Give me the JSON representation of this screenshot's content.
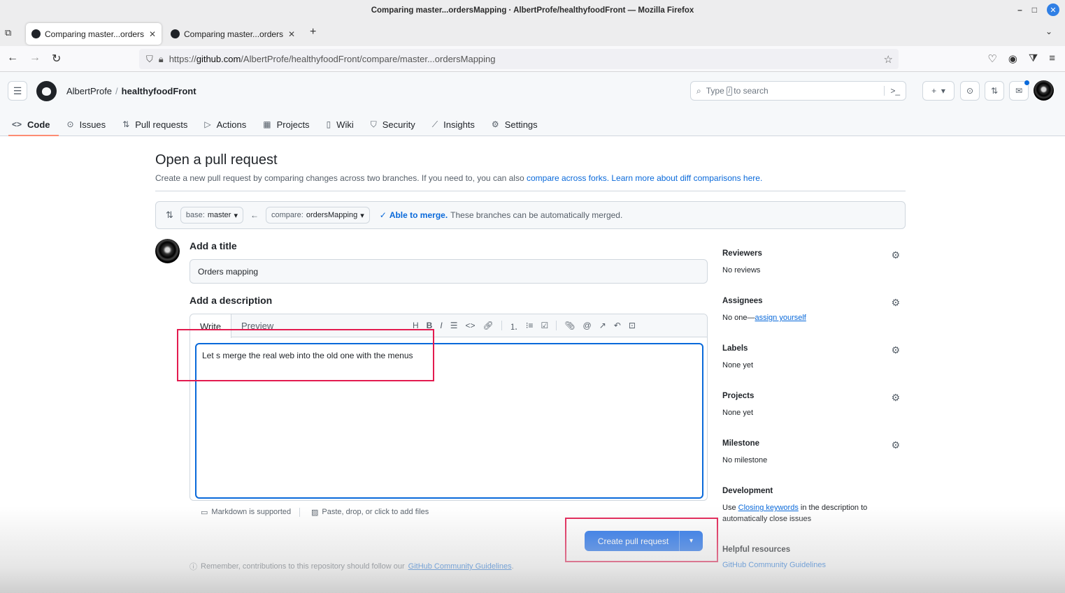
{
  "window": {
    "title": "Comparing master...ordersMapping · AlbertProfe/healthyfoodFront — Mozilla Firefox"
  },
  "tabs": [
    {
      "label": "Comparing master...ordersM"
    },
    {
      "label": "Comparing master...ordersM"
    }
  ],
  "url": {
    "prefix": "https://",
    "domain": "github.com",
    "path": "/AlbertProfe/healthyfoodFront/compare/master...ordersMapping"
  },
  "header": {
    "owner": "AlbertProfe",
    "separator": "/",
    "repo": "healthyfoodFront",
    "search_placeholder_pre": "Type",
    "search_key": "/",
    "search_placeholder_post": "to search"
  },
  "repo_nav": [
    {
      "label": "Code",
      "icon": "<>"
    },
    {
      "label": "Issues",
      "icon": "⊙"
    },
    {
      "label": "Pull requests",
      "icon": "⇅"
    },
    {
      "label": "Actions",
      "icon": "▷"
    },
    {
      "label": "Projects",
      "icon": "▦"
    },
    {
      "label": "Wiki",
      "icon": "▯"
    },
    {
      "label": "Security",
      "icon": "⛉"
    },
    {
      "label": "Insights",
      "icon": "⟋"
    },
    {
      "label": "Settings",
      "icon": "⚙"
    }
  ],
  "main": {
    "title": "Open a pull request",
    "subtitle_text": "Create a new pull request by comparing changes across two branches. If you need to, you can also",
    "subtitle_link1": "compare across forks.",
    "subtitle_link2": "Learn more about diff comparisons here.",
    "base_label": "base:",
    "base_value": "master",
    "compare_label": "compare:",
    "compare_value": "ordersMapping",
    "merge_status": "Able to merge.",
    "merge_message": "These branches can be automatically merged.",
    "add_title_label": "Add a title",
    "title_value": "Orders mapping",
    "add_description_label": "Add a description",
    "write_tab": "Write",
    "preview_tab": "Preview",
    "description_value": "Let s merge the real web into the old one with the menus",
    "markdown_note": "Markdown is supported",
    "attach_note": "Paste, drop, or click to add files",
    "create_button": "Create pull request",
    "remember_text": "Remember, contributions to this repository should follow our",
    "remember_link": "GitHub Community Guidelines",
    "remember_end": "."
  },
  "sidebar": {
    "reviewers": {
      "heading": "Reviewers",
      "value": "No reviews"
    },
    "assignees": {
      "heading": "Assignees",
      "value_pre": "No one—",
      "value_link": "assign yourself"
    },
    "labels": {
      "heading": "Labels",
      "value": "None yet"
    },
    "projects": {
      "heading": "Projects",
      "value": "None yet"
    },
    "milestone": {
      "heading": "Milestone",
      "value": "No milestone"
    },
    "development": {
      "heading": "Development",
      "value_pre": "Use",
      "value_link": "Closing keywords",
      "value_post": "in the description to automatically close issues"
    },
    "helpful": {
      "heading": "Helpful resources",
      "link": "GitHub Community Guidelines"
    }
  },
  "colors": {
    "accent": "#0969da",
    "primary_button": "#1f6feb",
    "highlight": "#e31b4f",
    "merge_ok": "#1a7f37"
  }
}
